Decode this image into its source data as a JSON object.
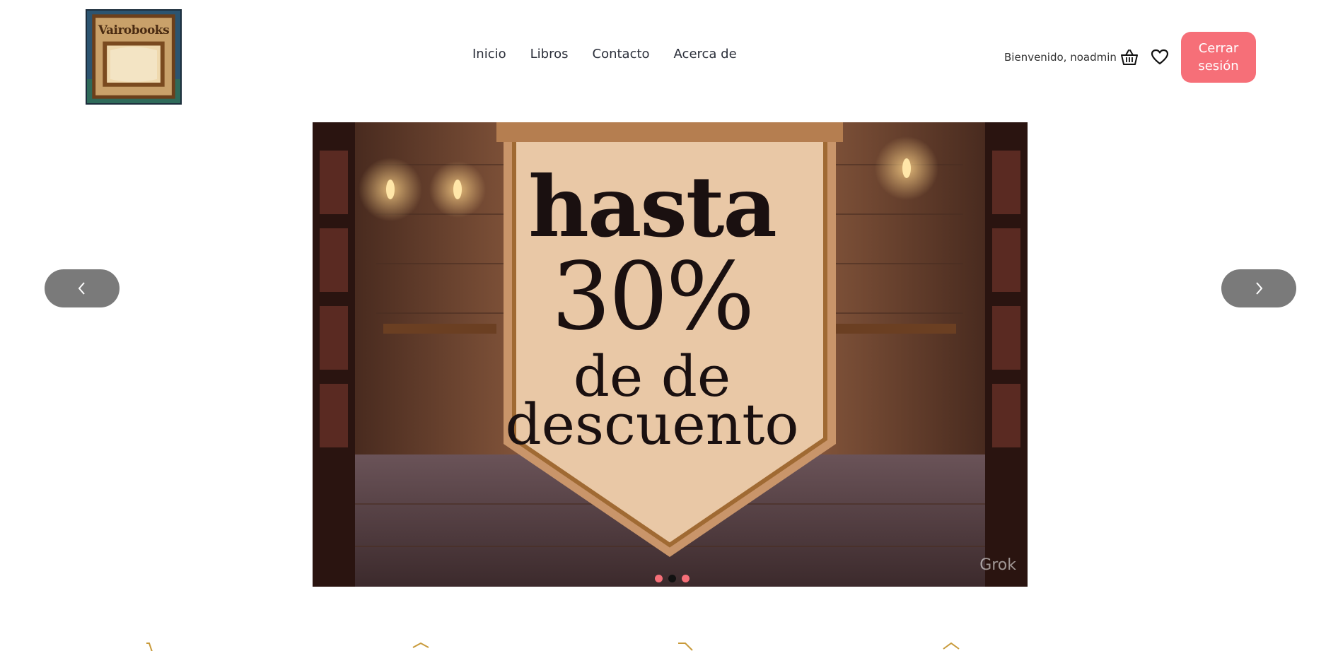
{
  "brand": {
    "logo_text": "Vairobooks"
  },
  "nav": {
    "items": [
      {
        "label": "Inicio"
      },
      {
        "label": "Libros"
      },
      {
        "label": "Contacto"
      },
      {
        "label": "Acerca de"
      }
    ]
  },
  "user": {
    "welcome": "Bienvenido, noadmin",
    "logout_label": "Cerrar sesión"
  },
  "carousel": {
    "slide": {
      "line1": "hasta",
      "line2": "30%",
      "line3": "de de",
      "line4": "descuento",
      "watermark": "Grok"
    },
    "slide_count": 3,
    "active_index": 1
  },
  "icons": {
    "basket": "basket-icon",
    "heart": "heart-icon",
    "prev": "chevron-left-icon",
    "next": "chevron-right-icon"
  },
  "colors": {
    "accent": "#f66f78",
    "arrow_bg": "#7a7a7a",
    "feature_icon": "#c89a3a"
  }
}
